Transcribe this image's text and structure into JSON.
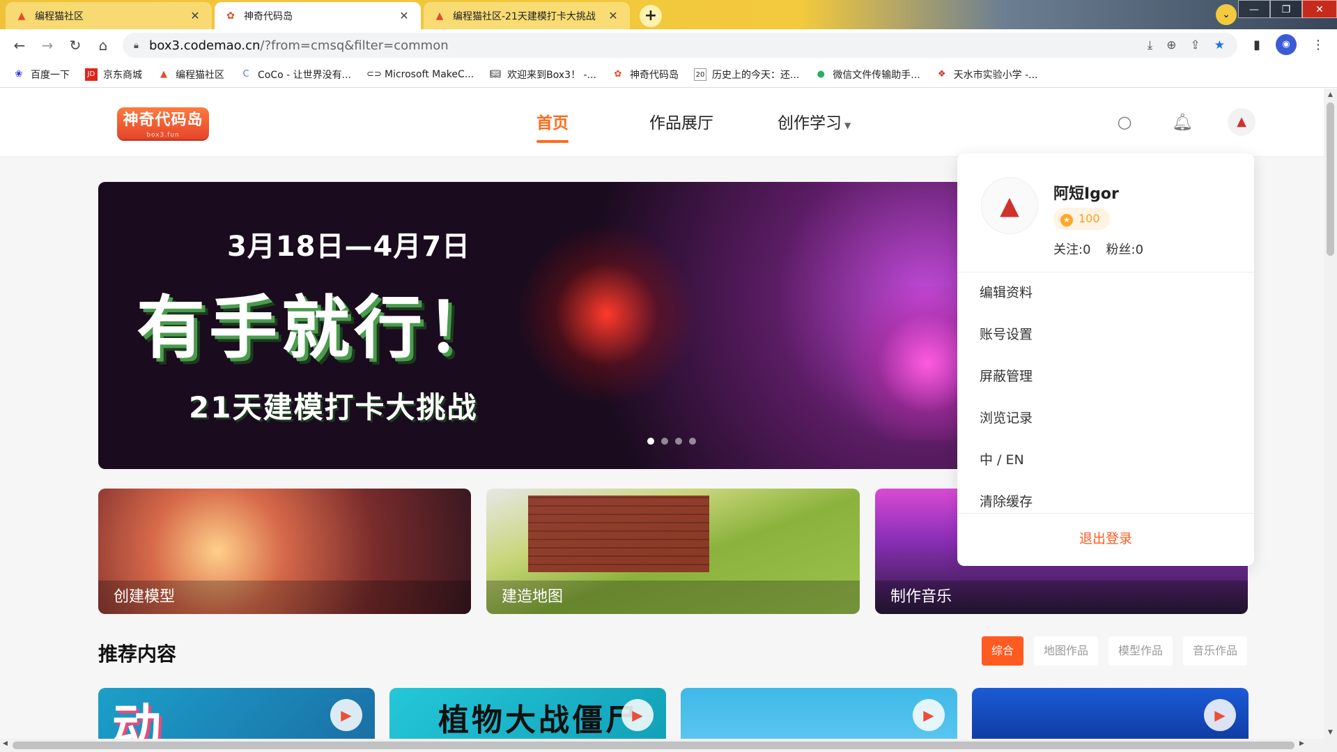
{
  "browser": {
    "tabs": [
      {
        "title": "编程猫社区",
        "icon": "codemao-cat-icon",
        "active": false
      },
      {
        "title": "神奇代码岛",
        "icon": "box3-flower-icon",
        "active": true
      },
      {
        "title": "编程猫社区-21天建模打卡大挑战",
        "icon": "codemao-cat-icon",
        "active": false
      }
    ],
    "new_tab": "+",
    "profile_dropdown": "⌄",
    "window_controls": [
      "—",
      "❐",
      "✕"
    ],
    "url_host": "box3.codemao.cn",
    "url_path": "/?from=cmsq&filter=common"
  },
  "bookmarks": [
    {
      "label": "百度一下",
      "icon": "baidu-paw-icon",
      "color": "#2932e1"
    },
    {
      "label": "京东商城",
      "icon": "jd-icon",
      "color": "#e1251b"
    },
    {
      "label": "编程猫社区",
      "icon": "codemao-cat-icon",
      "color": "#e34b2c"
    },
    {
      "label": "CoCo - 让世界没有...",
      "icon": "coco-icon",
      "color": "#5b6cf0"
    },
    {
      "label": "Microsoft MakeC...",
      "icon": "makecode-icon",
      "color": "#333333"
    },
    {
      "label": "欢迎来到Box3！ -...",
      "icon": "book-icon",
      "color": "#333333"
    },
    {
      "label": "神奇代码岛",
      "icon": "box3-flower-icon",
      "color": "#e34b2c"
    },
    {
      "label": "历史上的今天：还...",
      "icon": "calendar-icon",
      "color": "#333333"
    },
    {
      "label": "微信文件传输助手...",
      "icon": "wechat-icon",
      "color": "#2aae67"
    },
    {
      "label": "天水市实验小学 -...",
      "icon": "school-icon",
      "color": "#d42a2a"
    }
  ],
  "site": {
    "logo_text": "神奇代码岛",
    "logo_sub": "box3.fun",
    "nav": [
      {
        "label": "首页",
        "active": true
      },
      {
        "label": "作品展厅",
        "active": false
      },
      {
        "label": "创作学习",
        "active": false,
        "has_caret": true
      }
    ],
    "accent_color": "#ff6a1a"
  },
  "banner": {
    "date": "3月18日—4月7日",
    "headline": "有手就行！",
    "subtitle": "21天建模打卡大挑战",
    "slide_count": 4,
    "active_slide": 1
  },
  "categories": [
    {
      "label": "创建模型"
    },
    {
      "label": "建造地图"
    },
    {
      "label": "制作音乐"
    }
  ],
  "user_menu": {
    "name": "阿短Igor",
    "coins": "100",
    "following": "关注:0",
    "fans": "粉丝:0",
    "items": [
      "编辑资料",
      "账号设置",
      "屏蔽管理",
      "浏览记录",
      "中 / EN",
      "清除缓存"
    ],
    "logout": "退出登录"
  },
  "recommend": {
    "title": "推荐内容",
    "filters": [
      {
        "label": "综合",
        "active": true
      },
      {
        "label": "地图作品",
        "active": false
      },
      {
        "label": "模型作品",
        "active": false
      },
      {
        "label": "音乐作品",
        "active": false
      }
    ],
    "thumb_texts": [
      "动",
      "植物大战僵尸",
      "",
      ""
    ]
  }
}
